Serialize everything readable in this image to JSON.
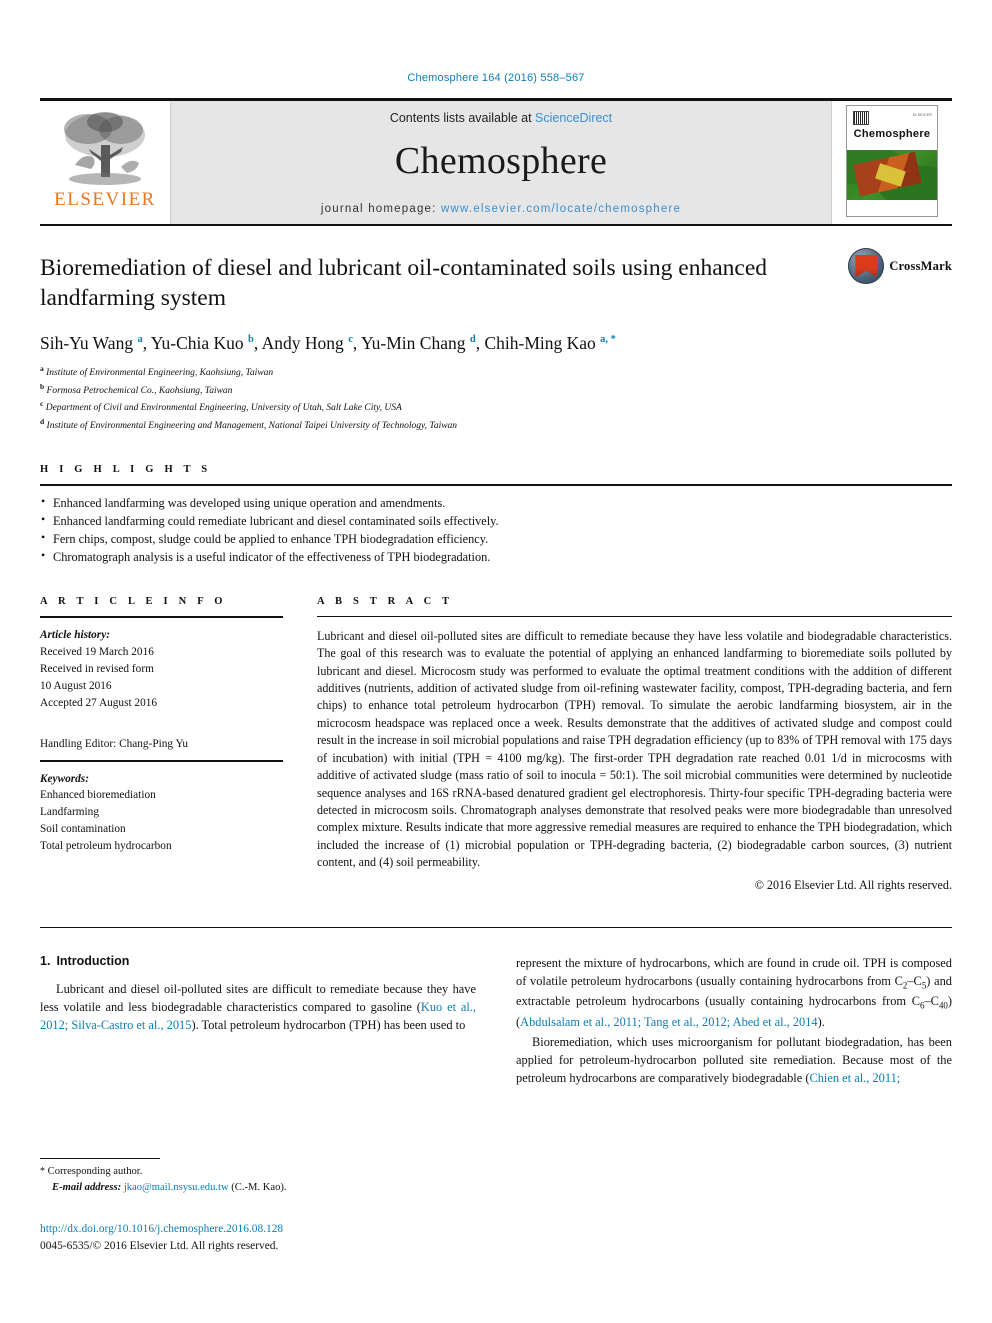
{
  "running_head": "Chemosphere 164 (2016) 558–567",
  "masthead": {
    "publisher_name": "ELSEVIER",
    "contents_prefix": "Contents lists available at ",
    "contents_link": "ScienceDirect",
    "journal_title": "Chemosphere",
    "homepage_prefix": "journal homepage: ",
    "homepage_url": "www.elsevier.com/locate/chemosphere",
    "cover_journal_name": "Chemosphere",
    "cover_corner_tag": "ELSEVIER"
  },
  "article": {
    "title": "Bioremediation of diesel and lubricant oil-contaminated soils using enhanced landfarming system",
    "crossmark_label": "CrossMark",
    "authors_html": "Sih-Yu Wang <sup>a</sup>, Yu-Chia Kuo <sup>b</sup>, Andy Hong <sup>c</sup>, Yu-Min Chang <sup>d</sup>, Chih-Ming Kao <sup>a, *</sup>",
    "affiliations": [
      {
        "marker": "a",
        "text": "Institute of Environmental Engineering, Kaohsiung, Taiwan"
      },
      {
        "marker": "b",
        "text": "Formosa Petrochemical Co., Kaohsiung, Taiwan"
      },
      {
        "marker": "c",
        "text": "Department of Civil and Environmental Engineering, University of Utah, Salt Lake City, USA"
      },
      {
        "marker": "d",
        "text": "Institute of Environmental Engineering and Management, National Taipei University of Technology, Taiwan"
      }
    ]
  },
  "highlights": {
    "heading": "H I G H L I G H T S",
    "items": [
      "Enhanced landfarming was developed using unique operation and amendments.",
      "Enhanced landfarming could remediate lubricant and diesel contaminated soils effectively.",
      "Fern chips, compost, sludge could be applied to enhance TPH biodegradation efficiency.",
      "Chromatograph analysis is a useful indicator of the effectiveness of TPH biodegradation."
    ]
  },
  "article_info": {
    "heading": "A R T I C L E   I N F O",
    "history_label": "Article history:",
    "history_lines": [
      "Received 19 March 2016",
      "Received in revised form",
      "10 August 2016",
      "Accepted 27 August 2016"
    ],
    "handling_editor": "Handling Editor: Chang-Ping Yu",
    "keywords_label": "Keywords:",
    "keywords": [
      "Enhanced bioremediation",
      "Landfarming",
      "Soil contamination",
      "Total petroleum hydrocarbon"
    ]
  },
  "abstract": {
    "heading": "A B S T R A C T",
    "text": "Lubricant and diesel oil-polluted sites are difficult to remediate because they have less volatile and biodegradable characteristics. The goal of this research was to evaluate the potential of applying an enhanced landfarming to bioremediate soils polluted by lubricant and diesel. Microcosm study was performed to evaluate the optimal treatment conditions with the addition of different additives (nutrients, addition of activated sludge from oil-refining wastewater facility, compost, TPH-degrading bacteria, and fern chips) to enhance total petroleum hydrocarbon (TPH) removal. To simulate the aerobic landfarming biosystem, air in the microcosm headspace was replaced once a week. Results demonstrate that the additives of activated sludge and compost could result in the increase in soil microbial populations and raise TPH degradation efficiency (up to 83% of TPH removal with 175 days of incubation) with initial (TPH = 4100 mg/kg). The first-order TPH degradation rate reached 0.01 1/d in microcosms with additive of activated sludge (mass ratio of soil to inocula = 50:1). The soil microbial communities were determined by nucleotide sequence analyses and 16S rRNA-based denatured gradient gel electrophoresis. Thirty-four specific TPH-degrading bacteria were detected in microcosm soils. Chromatograph analyses demonstrate that resolved peaks were more biodegradable than unresolved complex mixture. Results indicate that more aggressive remedial measures are required to enhance the TPH biodegradation, which included the increase of (1) microbial population or TPH-degrading bacteria, (2) biodegradable carbon sources, (3) nutrient content, and (4) soil permeability.",
    "copyright": "© 2016 Elsevier Ltd. All rights reserved."
  },
  "body": {
    "section_number": "1.",
    "section_title": "Introduction",
    "left_paragraph_html": "Lubricant and diesel oil-polluted sites are difficult to remediate because they have less volatile and less biodegradable characteristics compared to gasoline (<span class=\"cite\">Kuo et al., 2012; Silva-Castro et al., 2015</span>). Total petroleum hydrocarbon (TPH) has been used to",
    "right_paragraph_1_html": "represent the mixture of hydrocarbons, which are found in crude oil. TPH is composed of volatile petroleum hydrocarbons (usually containing hydrocarbons from C<sub>2</sub>–C<sub>5</sub>) and extractable petroleum hydrocarbons (usually containing hydrocarbons from C<sub>6</sub>–C<sub>40</sub>) (<span class=\"cite\">Abdulsalam et al., 2011; Tang et al., 2012; Abed et al., 2014</span>).",
    "right_paragraph_2_html": "Bioremediation, which uses microorganism for pollutant biodegradation, has been applied for petroleum-hydrocarbon polluted site remediation. Because most of the petroleum hydrocarbons are comparatively biodegradable (<span class=\"cite\">Chien et al., 2011;</span>"
  },
  "footnote": {
    "corresponding_marker": "*",
    "corresponding_text": "Corresponding author.",
    "email_label": "E-mail address:",
    "email": "jkao@mail.nsysu.edu.tw",
    "email_owner": "(C.-M. Kao).",
    "doi": "http://dx.doi.org/10.1016/j.chemosphere.2016.08.128",
    "issn_line": "0045-6535/© 2016 Elsevier Ltd. All rights reserved."
  },
  "colors": {
    "link_blue": "#0b7db5",
    "elsevier_orange": "#E87722",
    "masthead_grey": "#e6e6e6"
  }
}
